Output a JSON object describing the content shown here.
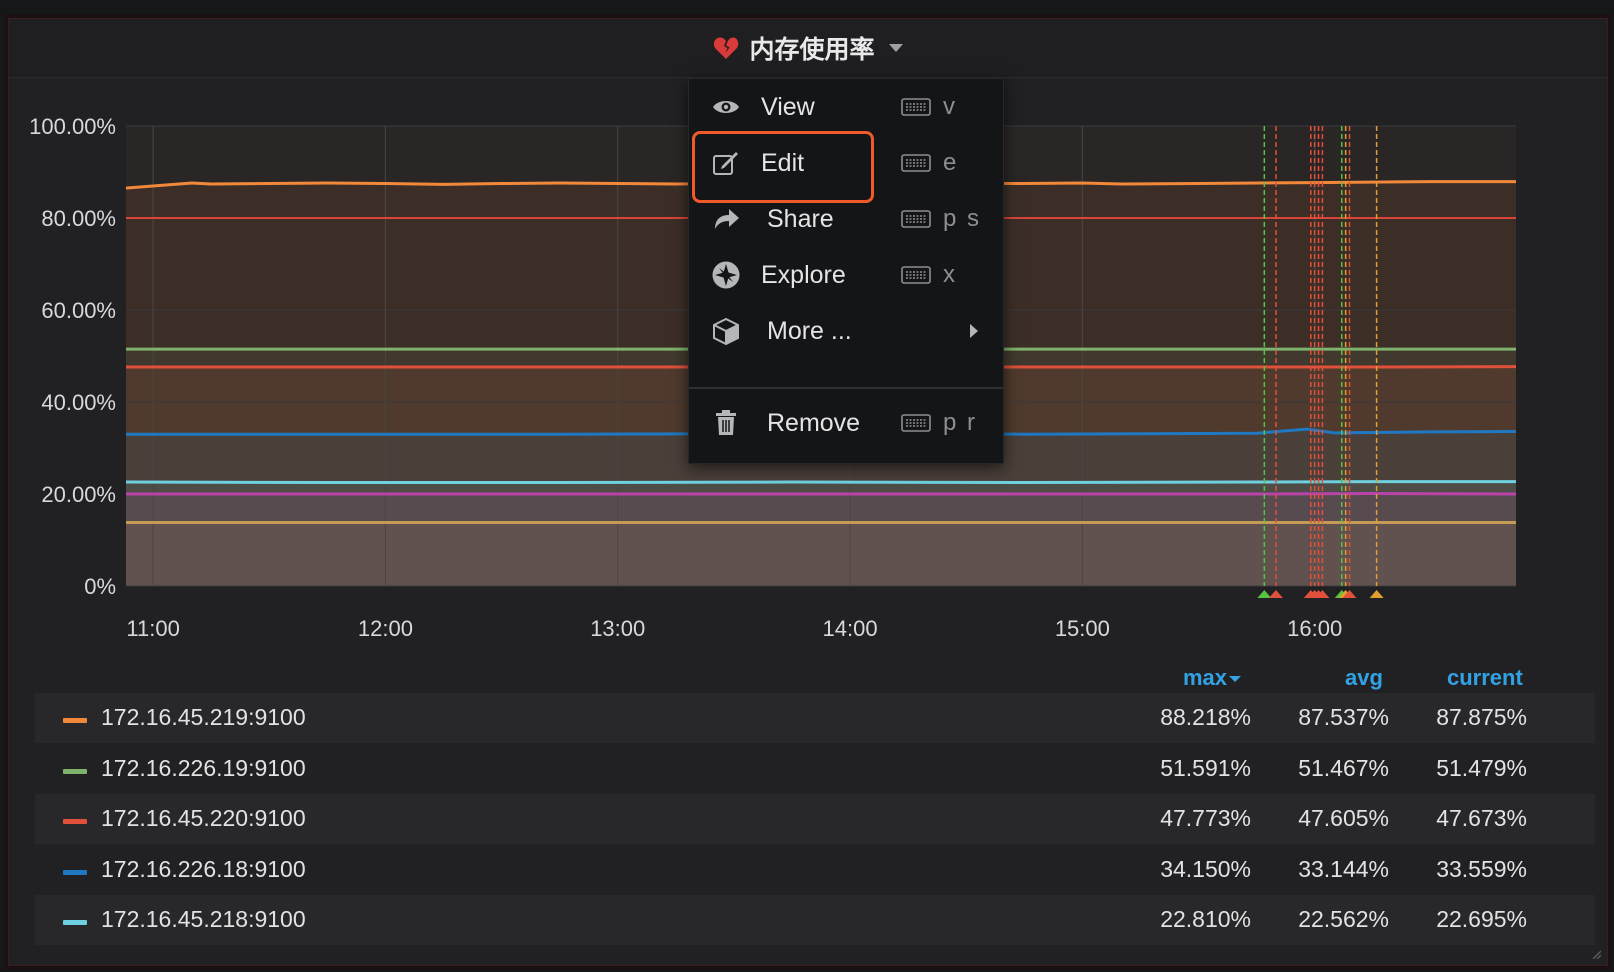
{
  "panel": {
    "title": "内存使用率",
    "title_icon": "broken-heart-icon",
    "dropdown_icon": "caret-down-icon"
  },
  "colors": {
    "orange": "#f2883a",
    "green": "#7eb26d",
    "red": "#e0503a",
    "blue": "#1f78c1",
    "cyan": "#6ed0e0",
    "magenta": "#ba43a9",
    "tan": "#c49a55",
    "highlight": "#f05a28",
    "legend_header": "#33a2e5"
  },
  "chart_data": {
    "type": "line",
    "x_ticks": [
      "11:00",
      "12:00",
      "13:00",
      "14:00",
      "15:00",
      "16:00"
    ],
    "y_ticks": [
      "0%",
      "20.00%",
      "40.00%",
      "60.00%",
      "80.00%",
      "100.00%"
    ],
    "ylim": [
      0,
      100
    ],
    "xlim": [
      "10:53",
      "16:52"
    ],
    "grid": true,
    "stacked_fill": true,
    "threshold": 80,
    "series": [
      {
        "name": "172.16.45.219:9100",
        "color": "#f2883a",
        "values": [
          86.5,
          87.6,
          87.4,
          87.5,
          87.6,
          87.5,
          87.3,
          87.5,
          87.6,
          87.5,
          87.4,
          87.5,
          87.4,
          87.5,
          87.6,
          87.5,
          87.5,
          87.6,
          87.4,
          87.5,
          87.6,
          87.7,
          87.9,
          87.9
        ],
        "x": [
          "10:53",
          "11:10",
          "11:15",
          "11:30",
          "11:45",
          "12:00",
          "12:15",
          "12:30",
          "12:45",
          "13:00",
          "13:15",
          "13:30",
          "13:45",
          "14:00",
          "14:15",
          "14:30",
          "14:45",
          "15:00",
          "15:10",
          "15:30",
          "15:45",
          "16:00",
          "16:30",
          "16:52"
        ]
      },
      {
        "name": "172.16.226.19:9100",
        "color": "#7eb26d",
        "values": [
          51.5,
          51.5,
          51.5,
          51.5,
          51.5,
          51.5,
          51.5,
          51.5
        ],
        "x": [
          "10:53",
          "11:45",
          "12:45",
          "13:45",
          "14:45",
          "15:45",
          "16:15",
          "16:52"
        ]
      },
      {
        "name": "172.16.45.220:9100",
        "color": "#e0503a",
        "values": [
          47.6,
          47.6,
          47.6,
          47.6,
          47.6,
          47.6,
          47.6,
          47.7
        ],
        "x": [
          "10:53",
          "11:45",
          "12:45",
          "13:45",
          "14:45",
          "15:45",
          "16:15",
          "16:52"
        ]
      },
      {
        "name": "172.16.226.18:9100",
        "color": "#1f78c1",
        "values": [
          33.0,
          33.0,
          33.0,
          33.1,
          33.0,
          33.2,
          34.1,
          33.3,
          33.5,
          33.6
        ],
        "x": [
          "10:53",
          "11:45",
          "12:45",
          "13:45",
          "14:45",
          "15:45",
          "15:58",
          "16:05",
          "16:30",
          "16:52"
        ]
      },
      {
        "name": "172.16.45.218:9100",
        "color": "#6ed0e0",
        "values": [
          22.6,
          22.5,
          22.5,
          22.6,
          22.5,
          22.6,
          22.7,
          22.7
        ],
        "x": [
          "10:53",
          "11:45",
          "12:45",
          "13:45",
          "14:45",
          "15:45",
          "16:15",
          "16:52"
        ]
      },
      {
        "color": "#ba43a9",
        "values": [
          20.0,
          20.0,
          20.0,
          20.0,
          20.0,
          20.0,
          20.1,
          20.0
        ],
        "x": [
          "10:53",
          "11:45",
          "12:45",
          "13:45",
          "14:45",
          "15:45",
          "16:15",
          "16:52"
        ]
      },
      {
        "color": "#c49a55",
        "values": [
          13.8,
          13.8,
          13.8,
          13.8,
          13.8,
          13.8,
          13.8,
          13.8
        ],
        "x": [
          "10:53",
          "11:45",
          "12:45",
          "13:45",
          "14:45",
          "15:45",
          "16:15",
          "16:52"
        ]
      }
    ],
    "annotations": [
      {
        "time": "15:47",
        "color": "#56c43f"
      },
      {
        "time": "15:50",
        "color": "#e0503a"
      },
      {
        "time": "15:59",
        "color": "#e0503a"
      },
      {
        "time": "16:00",
        "color": "#e0503a"
      },
      {
        "time": "16:01",
        "color": "#e0503a"
      },
      {
        "time": "16:02",
        "color": "#e0503a"
      },
      {
        "time": "16:07",
        "color": "#56c43f"
      },
      {
        "time": "16:08",
        "color": "#e0a030"
      },
      {
        "time": "16:09",
        "color": "#e0503a"
      },
      {
        "time": "16:16",
        "color": "#e0a030"
      }
    ]
  },
  "menu": {
    "items": [
      {
        "label": "View",
        "icon": "eye-icon",
        "key": "v"
      },
      {
        "label": "Edit",
        "icon": "edit-icon",
        "key": "e"
      },
      {
        "label": "Share",
        "icon": "share-icon",
        "key": "p s"
      },
      {
        "label": "Explore",
        "icon": "compass-icon",
        "key": "x"
      },
      {
        "label": "More ...",
        "icon": "cube-icon",
        "submenu_icon": "chevron-right-icon"
      },
      {
        "label": "Remove",
        "icon": "trash-icon",
        "key": "p r"
      }
    ],
    "keyboard_icon": "keyboard-icon",
    "highlighted": "Edit"
  },
  "legend": {
    "headers": [
      "max",
      "avg",
      "current"
    ],
    "sort_icon": "sort-desc-icon",
    "rows": [
      {
        "name": "172.16.45.219:9100",
        "color": "#f2883a",
        "max": "88.218%",
        "avg": "87.537%",
        "current": "87.875%"
      },
      {
        "name": "172.16.226.19:9100",
        "color": "#7eb26d",
        "max": "51.591%",
        "avg": "51.467%",
        "current": "51.479%"
      },
      {
        "name": "172.16.45.220:9100",
        "color": "#e0503a",
        "max": "47.773%",
        "avg": "47.605%",
        "current": "47.673%"
      },
      {
        "name": "172.16.226.18:9100",
        "color": "#1f78c1",
        "max": "34.150%",
        "avg": "33.144%",
        "current": "33.559%"
      },
      {
        "name": "172.16.45.218:9100",
        "color": "#6ed0e0",
        "max": "22.810%",
        "avg": "22.562%",
        "current": "22.695%"
      }
    ]
  }
}
